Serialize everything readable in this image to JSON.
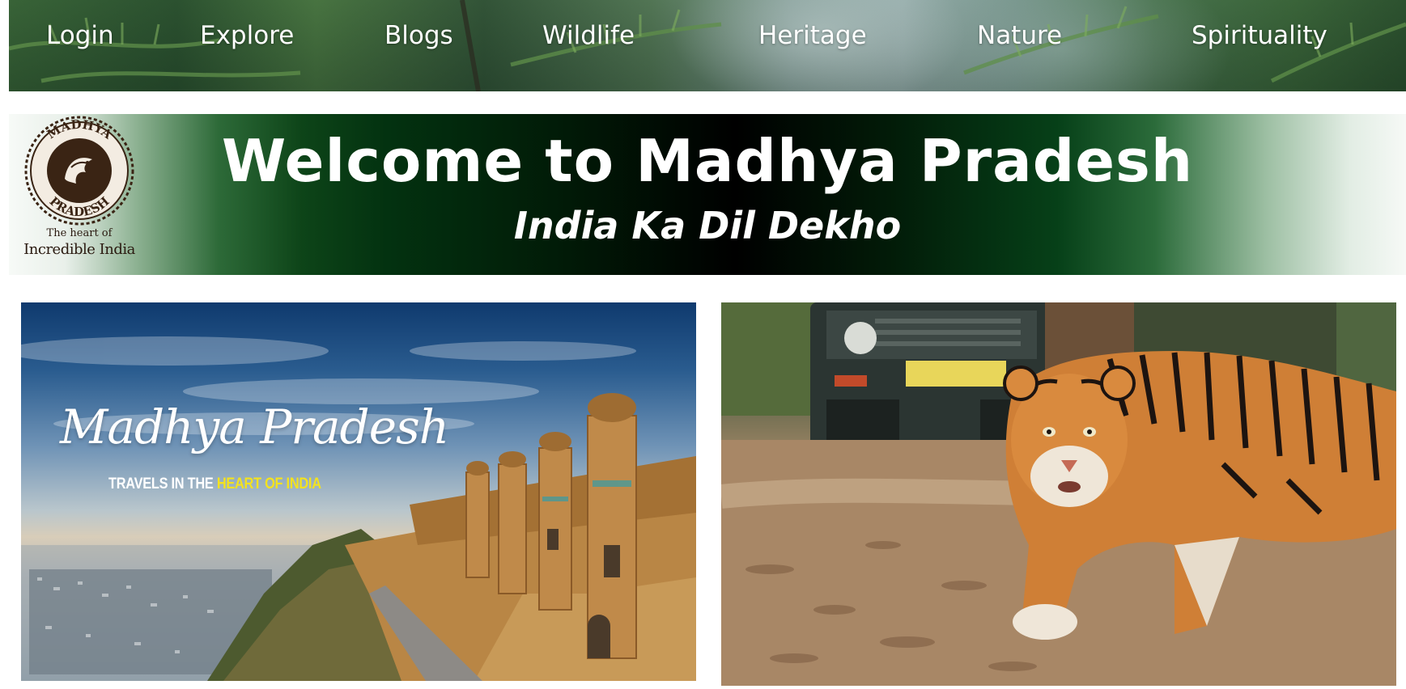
{
  "nav": {
    "items": [
      {
        "label": "Login"
      },
      {
        "label": "Explore"
      },
      {
        "label": "Blogs"
      },
      {
        "label": "Wildlife"
      },
      {
        "label": "Heritage"
      },
      {
        "label": "Nature"
      },
      {
        "label": "Spirituality"
      }
    ]
  },
  "banner": {
    "logo": {
      "ring_text": "MADHYA PRADESH",
      "tagline_line1": "The heart of",
      "tagline_line2": "Incredible India"
    },
    "title": "Welcome to Madhya Pradesh",
    "subtitle": "India Ka Dil Dekho"
  },
  "cards": {
    "heritage": {
      "script_title": "Madhya Pradesh",
      "tagline_prefix": "TRAVELS IN THE",
      "tagline_highlight": "HEART OF INDIA"
    },
    "wildlife": {}
  },
  "colors": {
    "banner_dark": "#000000",
    "banner_green": "#0d4418",
    "highlight_yellow": "#f3e21f",
    "text_white": "#ffffff",
    "logo_brown": "#3a2414"
  }
}
